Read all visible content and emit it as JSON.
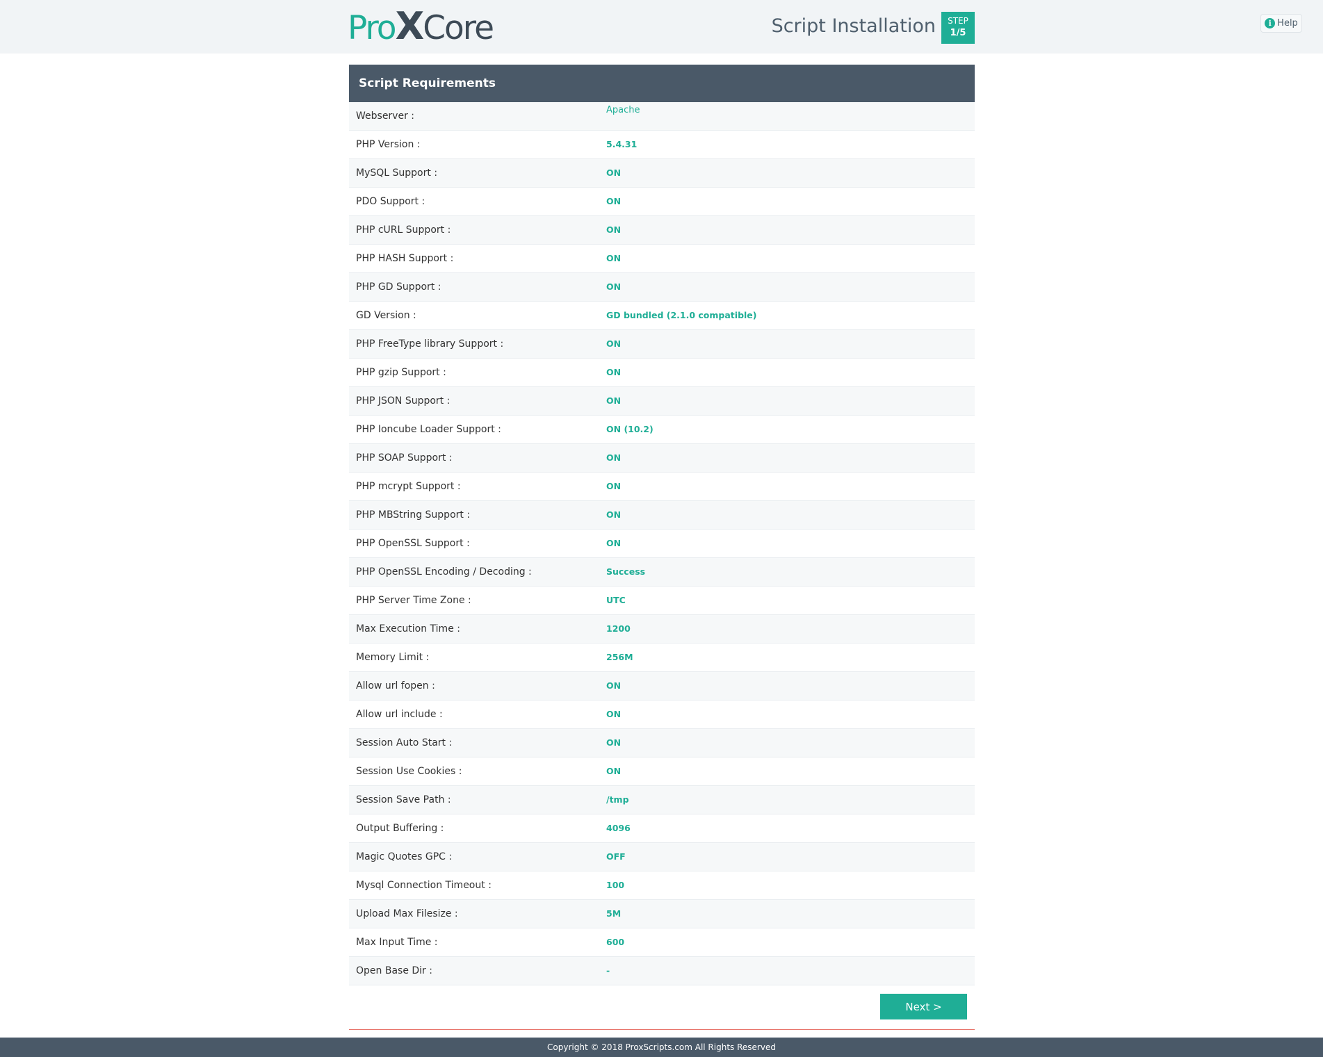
{
  "header": {
    "logo": {
      "part1": "Pro",
      "part2": "X",
      "part3": "Core"
    },
    "title": "Script Installation",
    "step_label": "STEP",
    "step_value": "1/5",
    "help_label": "Help",
    "help_icon": "info-icon"
  },
  "panel": {
    "title": "Script Requirements",
    "rows": [
      {
        "label": "Webserver :",
        "value": "Apache"
      },
      {
        "label": "PHP Version :",
        "value": "5.4.31"
      },
      {
        "label": "MySQL Support :",
        "value": "ON"
      },
      {
        "label": "PDO Support :",
        "value": "ON"
      },
      {
        "label": "PHP cURL Support :",
        "value": "ON"
      },
      {
        "label": "PHP HASH Support :",
        "value": "ON"
      },
      {
        "label": "PHP GD Support :",
        "value": "ON"
      },
      {
        "label": "GD Version :",
        "value": "GD bundled (2.1.0 compatible)"
      },
      {
        "label": "PHP FreeType library Support :",
        "value": "ON"
      },
      {
        "label": "PHP gzip Support :",
        "value": "ON"
      },
      {
        "label": "PHP JSON Support :",
        "value": "ON"
      },
      {
        "label": "PHP Ioncube Loader Support :",
        "value": "ON (10.2)"
      },
      {
        "label": "PHP SOAP Support :",
        "value": "ON"
      },
      {
        "label": "PHP mcrypt Support :",
        "value": "ON"
      },
      {
        "label": "PHP MBString Support :",
        "value": "ON"
      },
      {
        "label": "PHP OpenSSL Support :",
        "value": "ON"
      },
      {
        "label": "PHP OpenSSL Encoding / Decoding :",
        "value": "Success"
      },
      {
        "label": "PHP Server Time Zone :",
        "value": "UTC"
      },
      {
        "label": "Max Execution Time :",
        "value": "1200"
      },
      {
        "label": "Memory Limit :",
        "value": "256M"
      },
      {
        "label": "Allow url fopen :",
        "value": "ON"
      },
      {
        "label": "Allow url include :",
        "value": "ON"
      },
      {
        "label": "Session Auto Start :",
        "value": "ON"
      },
      {
        "label": "Session Use Cookies :",
        "value": "ON"
      },
      {
        "label": "Session Save Path :",
        "value": "/tmp"
      },
      {
        "label": "Output Buffering :",
        "value": "4096"
      },
      {
        "label": "Magic Quotes GPC :",
        "value": "OFF"
      },
      {
        "label": "Mysql Connection Timeout :",
        "value": "100"
      },
      {
        "label": "Upload Max Filesize :",
        "value": "5M"
      },
      {
        "label": "Max Input Time :",
        "value": "600"
      },
      {
        "label": "Open Base Dir :",
        "value": "-"
      }
    ]
  },
  "actions": {
    "next_label": "Next >"
  },
  "footer": {
    "copyright": "Copyright © 2018 ProxScripts.com All Rights Reserved"
  },
  "colors": {
    "accent": "#1fae96",
    "header_dark": "#4a5968",
    "footer_line": "#e8736a"
  }
}
